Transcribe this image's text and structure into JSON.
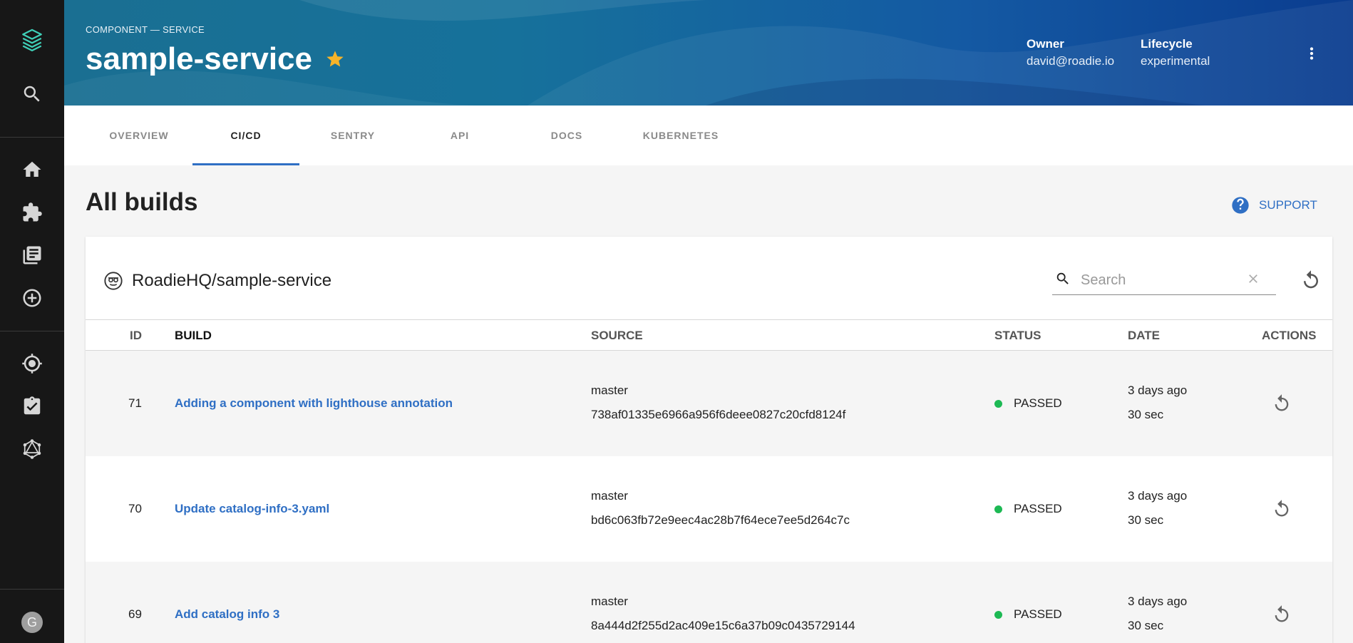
{
  "header": {
    "kicker": "COMPONENT — SERVICE",
    "title": "sample-service",
    "owner_label": "Owner",
    "owner_value": "david@roadie.io",
    "lifecycle_label": "Lifecycle",
    "lifecycle_value": "experimental"
  },
  "tabs": [
    {
      "label": "OVERVIEW"
    },
    {
      "label": "CI/CD"
    },
    {
      "label": "SENTRY"
    },
    {
      "label": "API"
    },
    {
      "label": "DOCS"
    },
    {
      "label": "KUBERNETES"
    }
  ],
  "active_tab": "CI/CD",
  "page": {
    "title": "All builds",
    "support_label": "SUPPORT"
  },
  "card": {
    "repo": "RoadieHQ/sample-service",
    "search_placeholder": "Search"
  },
  "table": {
    "columns": {
      "id": "ID",
      "build": "BUILD",
      "source": "SOURCE",
      "status": "STATUS",
      "date": "DATE",
      "actions": "ACTIONS"
    },
    "rows": [
      {
        "id": "71",
        "build": "Adding a component with lighthouse annotation",
        "branch": "master",
        "commit": "738af01335e6966a956f6deee0827c20cfd8124f",
        "status": "PASSED",
        "date": "3 days ago",
        "duration": "30 sec"
      },
      {
        "id": "70",
        "build": "Update catalog-info-3.yaml",
        "branch": "master",
        "commit": "bd6c063fb72e9eec4ac28b7f64ece7ee5d264c7c",
        "status": "PASSED",
        "date": "3 days ago",
        "duration": "30 sec"
      },
      {
        "id": "69",
        "build": "Add catalog info 3",
        "branch": "master",
        "commit": "8a444d2f255d2ac409e15c6a37b09c0435729144",
        "status": "PASSED",
        "date": "3 days ago",
        "duration": "30 sec"
      }
    ]
  },
  "user": {
    "avatar_initial": "G"
  },
  "colors": {
    "sidebar": "#171717",
    "accent": "#2f6fc4",
    "star": "#f7b329",
    "status_passed": "#1db954"
  },
  "icons": [
    "roadie-logo-icon",
    "search-icon",
    "home-icon",
    "puzzle-icon",
    "library-icon",
    "add-circle-icon",
    "target-icon",
    "assignment-check-icon",
    "graphql-icon",
    "star-icon",
    "more-vert-icon",
    "help-icon",
    "circleci-icon",
    "clear-icon",
    "refresh-icon",
    "retry-icon"
  ]
}
